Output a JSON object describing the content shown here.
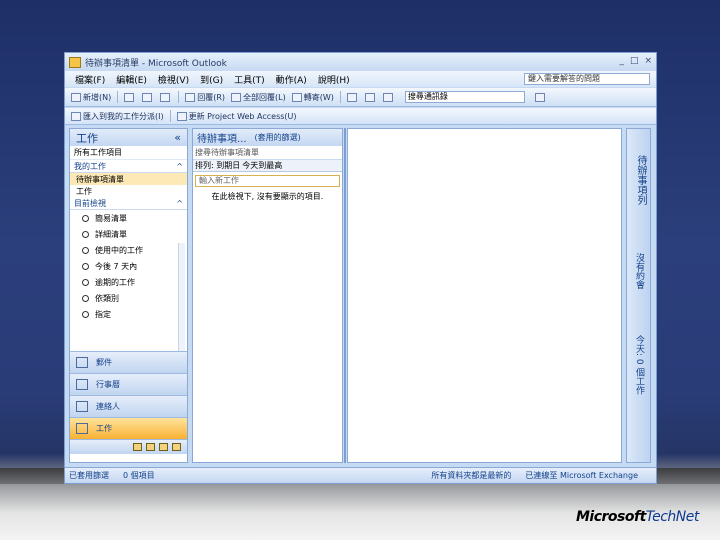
{
  "window": {
    "title": "待辦事項清單 - Microsoft Outlook",
    "controls": [
      "_",
      "□",
      "×"
    ]
  },
  "menubar": {
    "items": [
      "檔案(F)",
      "編輯(E)",
      "檢視(V)",
      "到(G)",
      "工具(T)",
      "動作(A)",
      "說明(H)"
    ],
    "help_placeholder": "鍵入需要解答的問題"
  },
  "toolbar": {
    "new_label": "新增(N)",
    "reply_label": "回覆(R)",
    "reply_all_label": "全部回覆(L)",
    "forward_label": "轉寄(W)",
    "search_value": "搜尋通訊錄"
  },
  "toolbar2": {
    "import_label": "匯入到我的工作分派(I)",
    "project_label": "更新 Project Web Access(U)"
  },
  "nav": {
    "title": "工作",
    "view_label": "所有工作項目",
    "my_tasks_header": "我的工作",
    "my_tasks": [
      "待辦事項清單",
      "工作"
    ],
    "current_view_header": "目前檢視",
    "views": [
      "簡易清單",
      "詳細清單",
      "使用中的工作",
      "今後 7 天內",
      "逾期的工作",
      "依類別",
      "指定"
    ],
    "buttons": [
      "郵件",
      "行事曆",
      "連絡人",
      "工作"
    ]
  },
  "list": {
    "title": "待辦事項...",
    "filter_label": "(套用的篩選)",
    "search_placeholder": "搜尋待辦事項清單",
    "sort_label": "排列: 到期日",
    "group_label": "今天到最高",
    "new_task_placeholder": "輸入新工作",
    "empty_message": "在此檢視下, 沒有要顯示的項目."
  },
  "todo_bar": {
    "title": "待辦事項列",
    "calendar_label": "沒有約會",
    "tasks_label": "今天: 0 個工作"
  },
  "status": {
    "filter": "已套用篩選",
    "count": "0 個項目",
    "sync": "所有資料夾都是最新的",
    "exchange": "已連線至 Microsoft Exchange"
  },
  "branding": {
    "company": "Microsoft",
    "product": "TechNet"
  }
}
